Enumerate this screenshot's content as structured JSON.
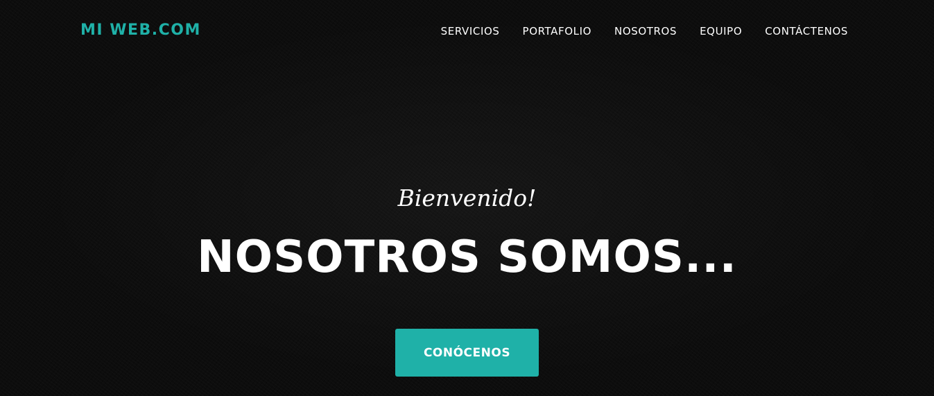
{
  "navbar": {
    "brand": "MI WEB.COM",
    "brand_color": "#1fb1a8",
    "links": [
      {
        "label": "SERVICIOS"
      },
      {
        "label": "PORTAFOLIO"
      },
      {
        "label": "NOSOTROS"
      },
      {
        "label": "EQUIPO"
      },
      {
        "label": "CONTÁCTENOS"
      }
    ]
  },
  "hero": {
    "subheading": "Bienvenido!",
    "heading": "NOSOTROS SOMOS...",
    "cta_label": "CONÓCENOS",
    "cta_color": "#1fb1a8"
  }
}
